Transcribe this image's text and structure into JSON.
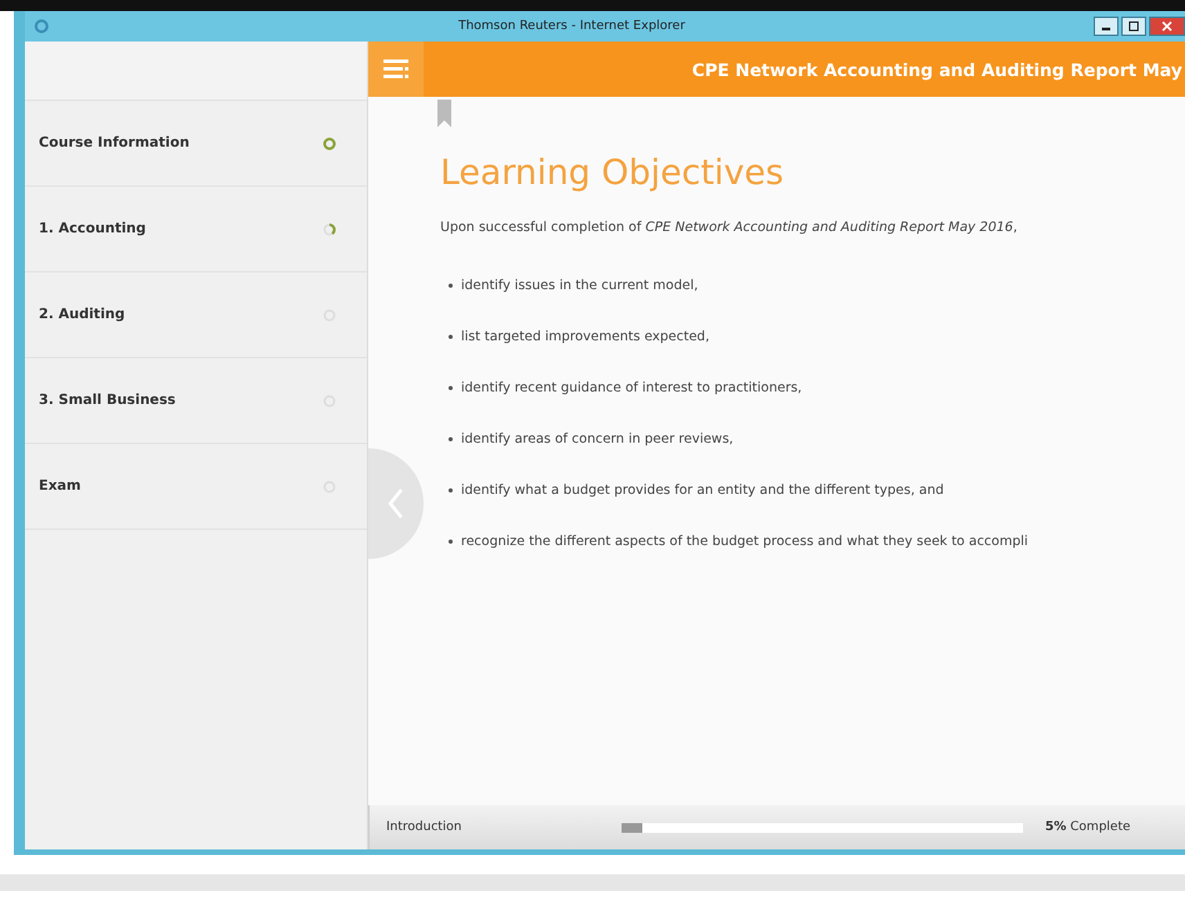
{
  "window": {
    "title": "Thomson Reuters - Internet Explorer"
  },
  "header": {
    "title": "CPE Network Accounting and Auditing Report May"
  },
  "sidebar": {
    "items": [
      {
        "label": "Course Information",
        "started": true,
        "completed": true,
        "selected": false
      },
      {
        "label": "1.  Accounting",
        "started": true,
        "completed": false,
        "selected": false
      },
      {
        "label": "2.  Auditing",
        "started": false,
        "completed": false,
        "selected": false
      },
      {
        "label": "3.  Small Business",
        "started": false,
        "completed": false,
        "selected": false
      },
      {
        "label": "Exam",
        "started": false,
        "completed": false,
        "selected": false
      }
    ]
  },
  "content": {
    "heading": "Learning Objectives",
    "intro": "Upon successful completion of *CPE Network Accounting and Auditing Report May 2016*,",
    "bullets": [
      "identify issues in the current model,",
      "list targeted improvements expected,",
      "identify recent guidance of interest to practitioners,",
      "identify areas of concern in peer reviews,",
      "identify what a budget provides for an entity and the different types, and",
      "recognize the different aspects of the budget process and what they seek to accompli"
    ]
  },
  "footer": {
    "section": "Introduction",
    "level": 0.05,
    "reading": "**5%** Complete"
  }
}
